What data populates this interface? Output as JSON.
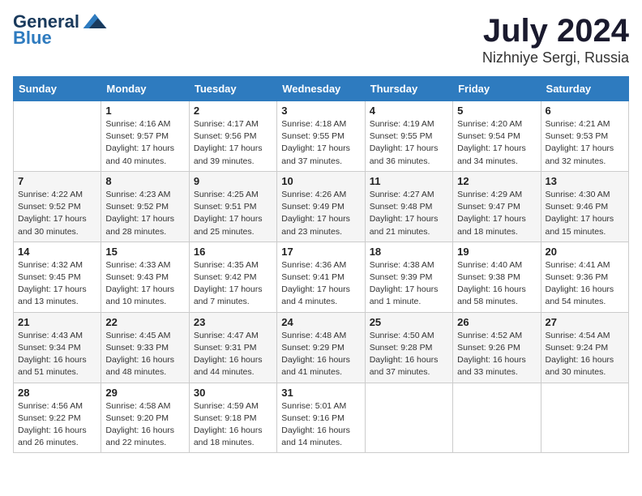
{
  "logo": {
    "line1": "General",
    "line2": "Blue"
  },
  "title": "July 2024",
  "location": "Nizhniye Sergi, Russia",
  "days_of_week": [
    "Sunday",
    "Monday",
    "Tuesday",
    "Wednesday",
    "Thursday",
    "Friday",
    "Saturday"
  ],
  "weeks": [
    [
      {
        "num": "",
        "info": ""
      },
      {
        "num": "1",
        "info": "Sunrise: 4:16 AM\nSunset: 9:57 PM\nDaylight: 17 hours\nand 40 minutes."
      },
      {
        "num": "2",
        "info": "Sunrise: 4:17 AM\nSunset: 9:56 PM\nDaylight: 17 hours\nand 39 minutes."
      },
      {
        "num": "3",
        "info": "Sunrise: 4:18 AM\nSunset: 9:55 PM\nDaylight: 17 hours\nand 37 minutes."
      },
      {
        "num": "4",
        "info": "Sunrise: 4:19 AM\nSunset: 9:55 PM\nDaylight: 17 hours\nand 36 minutes."
      },
      {
        "num": "5",
        "info": "Sunrise: 4:20 AM\nSunset: 9:54 PM\nDaylight: 17 hours\nand 34 minutes."
      },
      {
        "num": "6",
        "info": "Sunrise: 4:21 AM\nSunset: 9:53 PM\nDaylight: 17 hours\nand 32 minutes."
      }
    ],
    [
      {
        "num": "7",
        "info": "Sunrise: 4:22 AM\nSunset: 9:52 PM\nDaylight: 17 hours\nand 30 minutes."
      },
      {
        "num": "8",
        "info": "Sunrise: 4:23 AM\nSunset: 9:52 PM\nDaylight: 17 hours\nand 28 minutes."
      },
      {
        "num": "9",
        "info": "Sunrise: 4:25 AM\nSunset: 9:51 PM\nDaylight: 17 hours\nand 25 minutes."
      },
      {
        "num": "10",
        "info": "Sunrise: 4:26 AM\nSunset: 9:49 PM\nDaylight: 17 hours\nand 23 minutes."
      },
      {
        "num": "11",
        "info": "Sunrise: 4:27 AM\nSunset: 9:48 PM\nDaylight: 17 hours\nand 21 minutes."
      },
      {
        "num": "12",
        "info": "Sunrise: 4:29 AM\nSunset: 9:47 PM\nDaylight: 17 hours\nand 18 minutes."
      },
      {
        "num": "13",
        "info": "Sunrise: 4:30 AM\nSunset: 9:46 PM\nDaylight: 17 hours\nand 15 minutes."
      }
    ],
    [
      {
        "num": "14",
        "info": "Sunrise: 4:32 AM\nSunset: 9:45 PM\nDaylight: 17 hours\nand 13 minutes."
      },
      {
        "num": "15",
        "info": "Sunrise: 4:33 AM\nSunset: 9:43 PM\nDaylight: 17 hours\nand 10 minutes."
      },
      {
        "num": "16",
        "info": "Sunrise: 4:35 AM\nSunset: 9:42 PM\nDaylight: 17 hours\nand 7 minutes."
      },
      {
        "num": "17",
        "info": "Sunrise: 4:36 AM\nSunset: 9:41 PM\nDaylight: 17 hours\nand 4 minutes."
      },
      {
        "num": "18",
        "info": "Sunrise: 4:38 AM\nSunset: 9:39 PM\nDaylight: 17 hours\nand 1 minute."
      },
      {
        "num": "19",
        "info": "Sunrise: 4:40 AM\nSunset: 9:38 PM\nDaylight: 16 hours\nand 58 minutes."
      },
      {
        "num": "20",
        "info": "Sunrise: 4:41 AM\nSunset: 9:36 PM\nDaylight: 16 hours\nand 54 minutes."
      }
    ],
    [
      {
        "num": "21",
        "info": "Sunrise: 4:43 AM\nSunset: 9:34 PM\nDaylight: 16 hours\nand 51 minutes."
      },
      {
        "num": "22",
        "info": "Sunrise: 4:45 AM\nSunset: 9:33 PM\nDaylight: 16 hours\nand 48 minutes."
      },
      {
        "num": "23",
        "info": "Sunrise: 4:47 AM\nSunset: 9:31 PM\nDaylight: 16 hours\nand 44 minutes."
      },
      {
        "num": "24",
        "info": "Sunrise: 4:48 AM\nSunset: 9:29 PM\nDaylight: 16 hours\nand 41 minutes."
      },
      {
        "num": "25",
        "info": "Sunrise: 4:50 AM\nSunset: 9:28 PM\nDaylight: 16 hours\nand 37 minutes."
      },
      {
        "num": "26",
        "info": "Sunrise: 4:52 AM\nSunset: 9:26 PM\nDaylight: 16 hours\nand 33 minutes."
      },
      {
        "num": "27",
        "info": "Sunrise: 4:54 AM\nSunset: 9:24 PM\nDaylight: 16 hours\nand 30 minutes."
      }
    ],
    [
      {
        "num": "28",
        "info": "Sunrise: 4:56 AM\nSunset: 9:22 PM\nDaylight: 16 hours\nand 26 minutes."
      },
      {
        "num": "29",
        "info": "Sunrise: 4:58 AM\nSunset: 9:20 PM\nDaylight: 16 hours\nand 22 minutes."
      },
      {
        "num": "30",
        "info": "Sunrise: 4:59 AM\nSunset: 9:18 PM\nDaylight: 16 hours\nand 18 minutes."
      },
      {
        "num": "31",
        "info": "Sunrise: 5:01 AM\nSunset: 9:16 PM\nDaylight: 16 hours\nand 14 minutes."
      },
      {
        "num": "",
        "info": ""
      },
      {
        "num": "",
        "info": ""
      },
      {
        "num": "",
        "info": ""
      }
    ]
  ]
}
